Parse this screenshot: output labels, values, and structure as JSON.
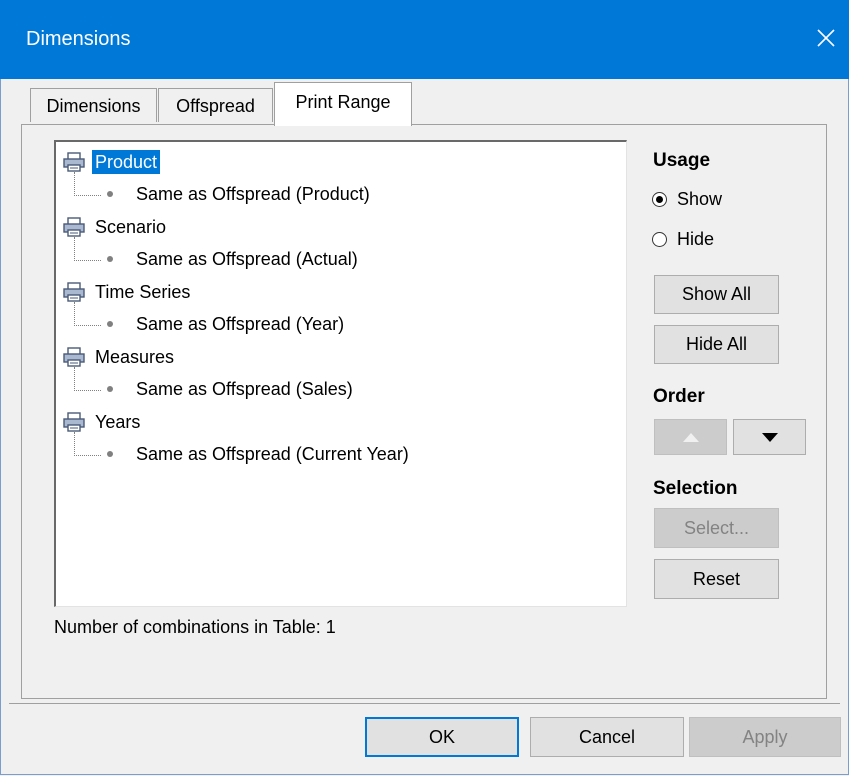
{
  "window": {
    "title": "Dimensions"
  },
  "tabs": [
    {
      "label": "Dimensions",
      "active": false
    },
    {
      "label": "Offspread",
      "active": false
    },
    {
      "label": "Print Range",
      "active": true
    }
  ],
  "tree": {
    "items": [
      {
        "label": "Product",
        "child": "Same as Offspread (Product)",
        "selected": true
      },
      {
        "label": "Scenario",
        "child": "Same as Offspread (Actual)",
        "selected": false
      },
      {
        "label": "Time Series",
        "child": "Same as Offspread (Year)",
        "selected": false
      },
      {
        "label": "Measures",
        "child": "Same as Offspread (Sales)",
        "selected": false
      },
      {
        "label": "Years",
        "child": "Same as Offspread (Current Year)",
        "selected": false
      }
    ]
  },
  "combinations_text": "Number of combinations in Table: 1",
  "usage": {
    "header": "Usage",
    "show_label": "Show",
    "hide_label": "Hide",
    "selected": "Show",
    "show_all": "Show All",
    "hide_all": "Hide All"
  },
  "order": {
    "header": "Order",
    "up_icon": "triangle-up-icon",
    "down_icon": "triangle-down-icon"
  },
  "selection": {
    "header": "Selection",
    "select_label": "Select...",
    "reset_label": "Reset"
  },
  "footer": {
    "ok": "OK",
    "cancel": "Cancel",
    "apply": "Apply"
  },
  "colors": {
    "titlebar": "#0078d7",
    "selection": "#0078d7"
  }
}
